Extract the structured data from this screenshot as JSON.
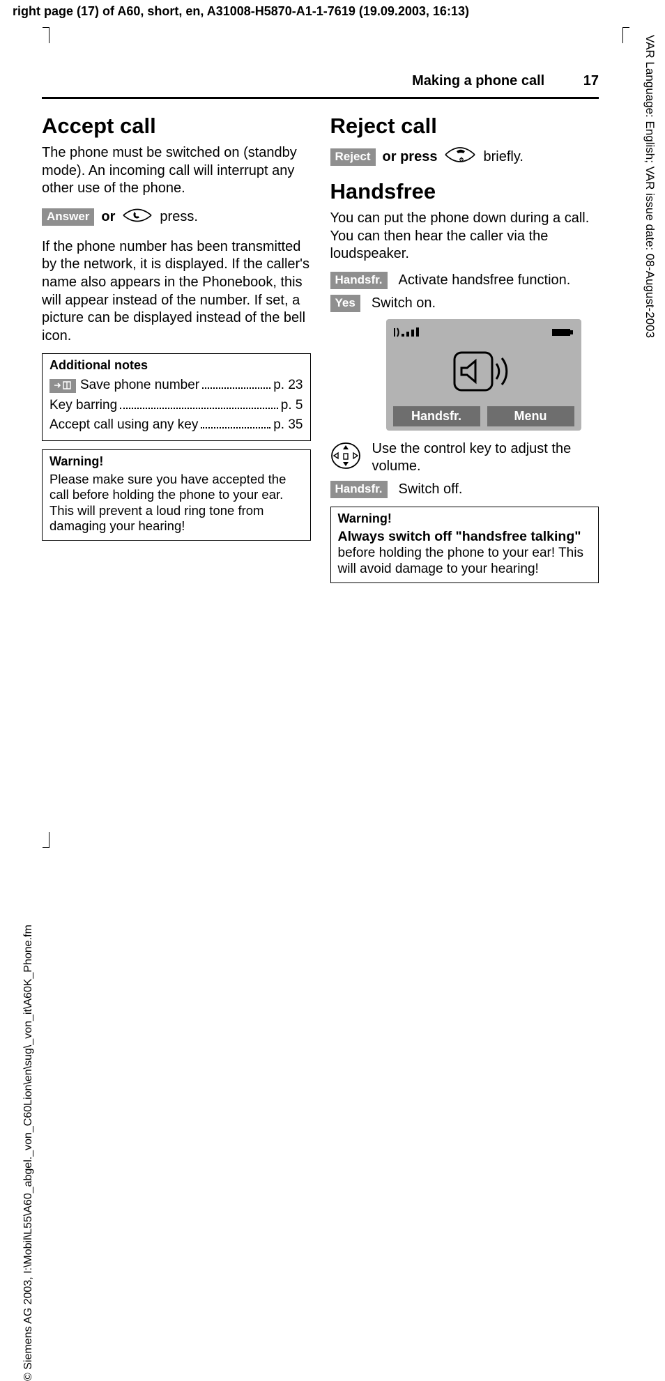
{
  "top_header": "right page (17) of A60, short, en, A31008-H5870-A1-1-7619 (19.09.2003, 16:13)",
  "left_sidebar": "© Siemens AG 2003, I:\\Mobil\\L55\\A60_abgel._von_C60Lion\\en\\sug\\_von_it\\A60K_Phone.fm",
  "right_sidebar": "VAR Language: English; VAR issue date: 08-August-2003",
  "page_header": {
    "section": "Making a phone call",
    "page": "17"
  },
  "left": {
    "h1": "Accept call",
    "p1": "The phone must be switched on (standby mode). An incoming call will interrupt any other use of the phone.",
    "answer_btn": "Answer",
    "answer_or": "or",
    "answer_tail": "press.",
    "p2": "If the phone number has been transmitted by the network, it is displayed. If the caller's name also appears in the Phonebook, this will appear instead of the number. If set, a picture can be displayed instead of the bell icon.",
    "notes": {
      "title": "Additional notes",
      "save_icon": "→␣",
      "items": [
        {
          "label": "Save phone number",
          "page": "p. 23",
          "has_icon": true
        },
        {
          "label": "Key barring",
          "page": "p. 5",
          "has_icon": false
        },
        {
          "label": "Accept call using any key",
          "page": "p. 35",
          "has_icon": false
        }
      ]
    },
    "warn": {
      "title": "Warning!",
      "body": "Please make sure you have accepted the call before holding the phone to your ear. This will prevent a loud ring tone from damaging your hearing!"
    }
  },
  "right": {
    "h1a": "Reject call",
    "reject_btn": "Reject",
    "reject_or": "or press",
    "reject_tail": "briefly.",
    "h1b": "Handsfree",
    "p1": "You can put the phone down during a call. You can then hear the caller via the loudspeaker.",
    "hf_btn": "Handsfr.",
    "hf_desc": "Activate handsfree function.",
    "yes_btn": "Yes",
    "yes_desc": "Switch on.",
    "screen": {
      "sk_left": "Handsfr.",
      "sk_right": "Menu"
    },
    "ctrl_desc": "Use the control key to adjust the volume.",
    "hf_off_btn": "Handsfr.",
    "hf_off_desc": "Switch off.",
    "warn": {
      "title": "Warning!",
      "strong": "Always switch off \"handsfree talking\"",
      "rest": " before holding the phone to your ear! This will avoid damage to your hearing!"
    }
  }
}
